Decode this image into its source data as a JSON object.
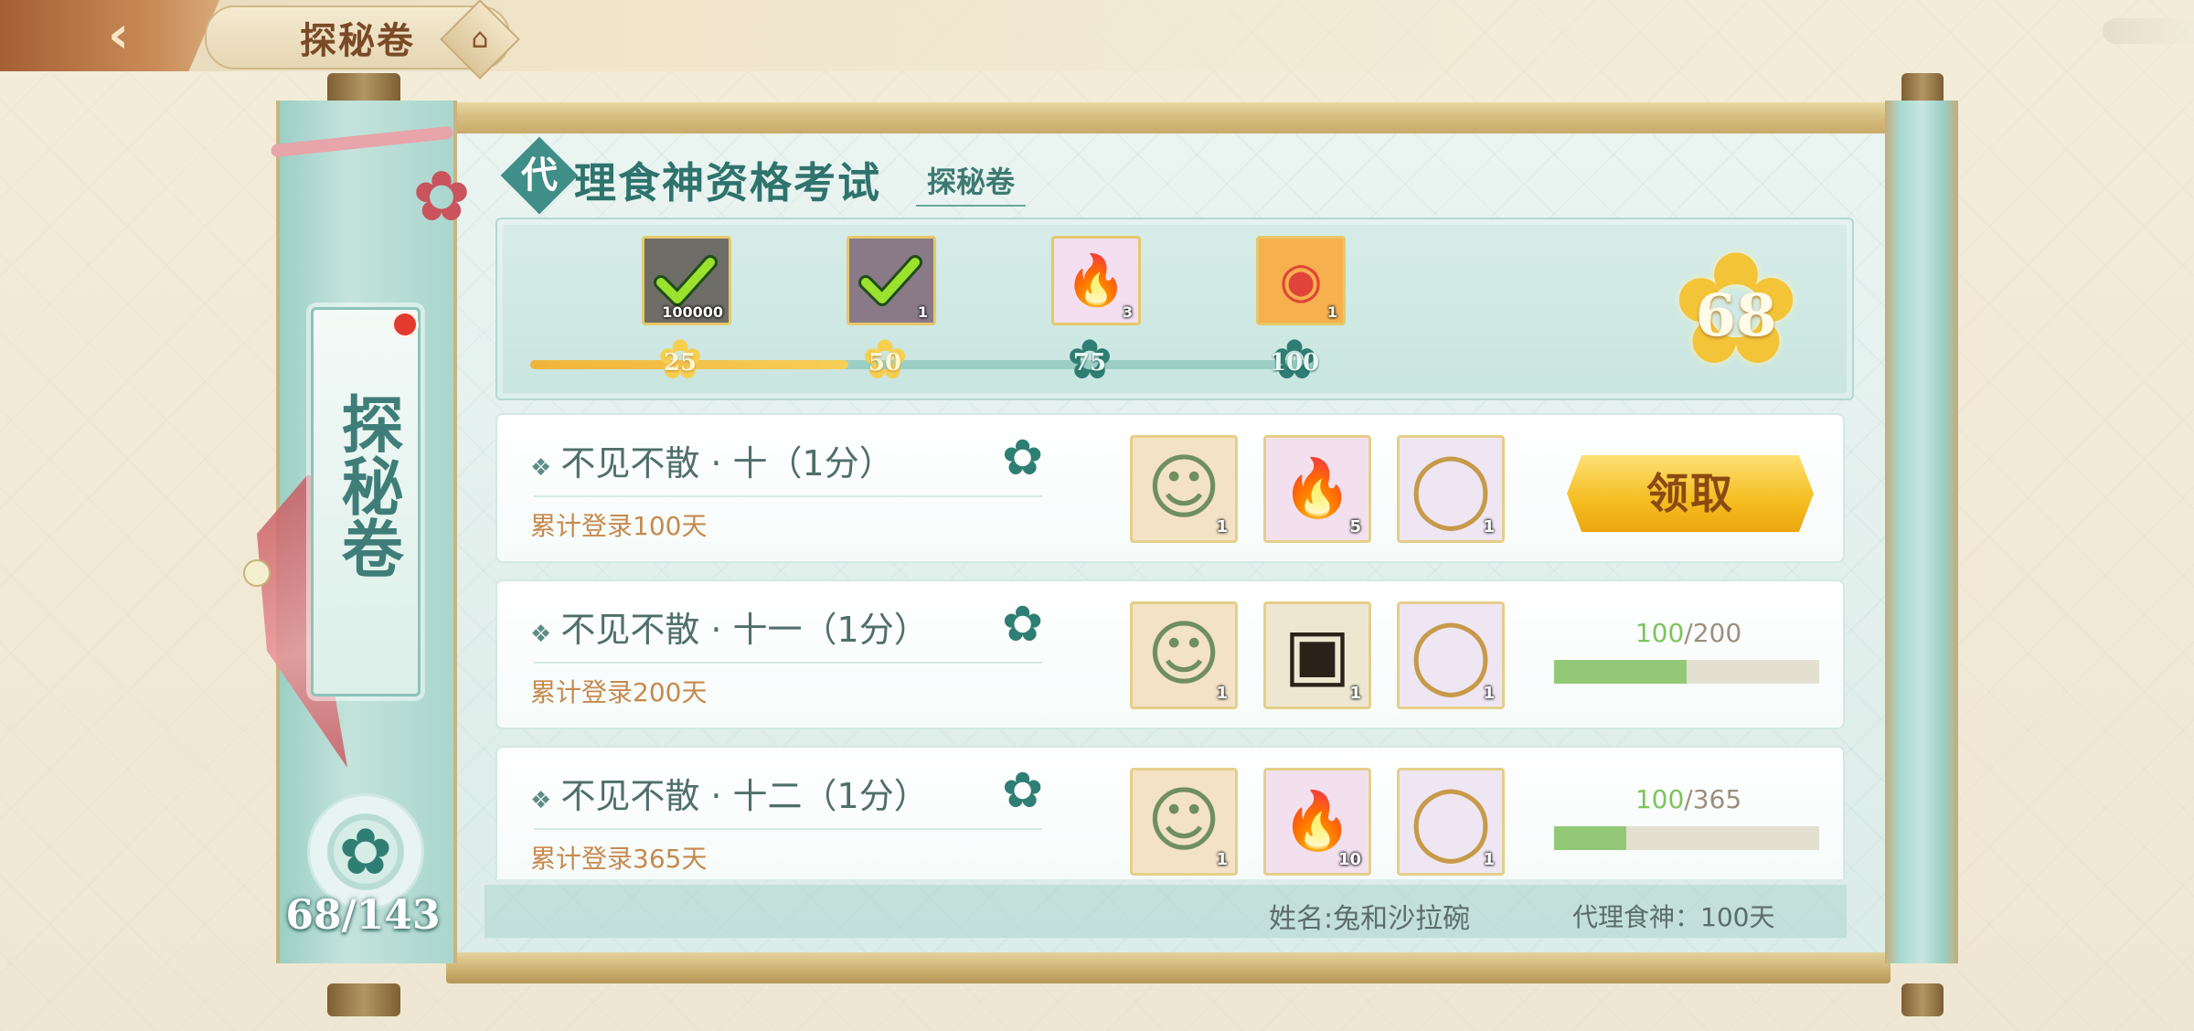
{
  "topbar": {
    "back_icon": "back-arrow-icon",
    "title": "探秘卷",
    "home_icon": "pagoda-home-icon"
  },
  "left_panel": {
    "title": "探秘卷",
    "emblem_icon": "sakura-emblem-icon",
    "progress": "68/143"
  },
  "heading": {
    "first_char": "代",
    "rest": "理食神资格考试",
    "subtitle": "探秘卷"
  },
  "track": {
    "milestones": [
      {
        "points": "25",
        "item_icon": "coin-pouch-icon",
        "count": "100000",
        "claimed": true,
        "bg": "#6f6d68"
      },
      {
        "points": "50",
        "item_icon": "jade-item-icon",
        "count": "1",
        "claimed": true,
        "bg": "#8a7a88"
      },
      {
        "points": "75",
        "item_icon": "fire-spirit-icon",
        "count": "3",
        "claimed": false,
        "bg": "#f3dff0"
      },
      {
        "points": "100",
        "item_icon": "red-seal-medal-icon",
        "count": "1",
        "claimed": false,
        "bg": "#f6b04d"
      }
    ],
    "progress_fraction": 0.405,
    "points": "68"
  },
  "tasks": [
    {
      "name": "不见不散 · 十（1分）",
      "desc": "累计登录100天",
      "rewards": [
        {
          "icon": "chef-portrait-icon",
          "count": "1",
          "bg": "#f3e2c6"
        },
        {
          "icon": "fire-spirit-icon",
          "count": "5",
          "bg": "#f2e0ef"
        },
        {
          "icon": "wreath-frame-icon",
          "count": "1",
          "bg": "#efe6f3"
        }
      ],
      "status": "claim",
      "claim_label": "领取"
    },
    {
      "name": "不见不散 · 十一（1分）",
      "desc": "累计登录200天",
      "rewards": [
        {
          "icon": "chef-portrait-icon",
          "count": "1",
          "bg": "#f3e2c6"
        },
        {
          "icon": "lacquer-chest-icon",
          "count": "1",
          "bg": "#ede7d2"
        },
        {
          "icon": "floral-wreath-icon",
          "count": "1",
          "bg": "#efe6f3"
        }
      ],
      "status": "progress",
      "current": "100",
      "total": "/200",
      "fraction": 0.5
    },
    {
      "name": "不见不散 · 十二（1分）",
      "desc": "累计登录365天",
      "rewards": [
        {
          "icon": "chef-portrait-icon",
          "count": "1",
          "bg": "#f3e2c6"
        },
        {
          "icon": "fire-spirit-icon",
          "count": "10",
          "bg": "#f2e0ef"
        },
        {
          "icon": "ribbon-wreath-icon",
          "count": "1",
          "bg": "#efe6f3"
        }
      ],
      "status": "progress",
      "current": "100",
      "total": "/365",
      "fraction": 0.274
    }
  ],
  "footer": {
    "name": "姓名:兔和沙拉碗",
    "days": "代理食神：100天"
  },
  "colors": {
    "accent_teal": "#2f7e73",
    "gold": "#f3c437",
    "progress_green": "#93c976"
  }
}
